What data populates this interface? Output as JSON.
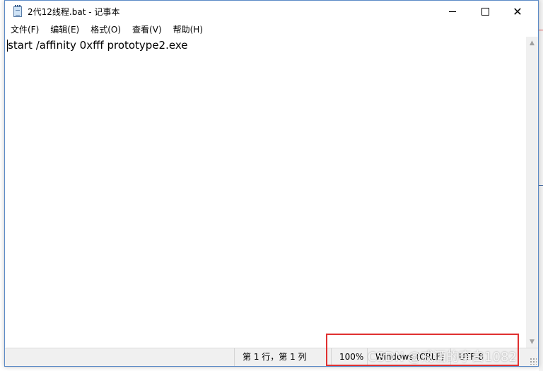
{
  "window": {
    "title": "2代12线程.bat - 记事本",
    "app_icon": "notepad-icon"
  },
  "menu": [
    {
      "label": "文件(F)"
    },
    {
      "label": "编辑(E)"
    },
    {
      "label": "格式(O)"
    },
    {
      "label": "查看(V)"
    },
    {
      "label": "帮助(H)"
    }
  ],
  "editor": {
    "content": "start /affinity 0xfff prototype2.exe"
  },
  "status": {
    "position": "第 1 行，第 1 列",
    "zoom": "100%",
    "line_ending": "Windows (CRLF)",
    "encoding": "UTF-8"
  },
  "watermark": {
    "text": "CSDN @戒酒的李白1082"
  },
  "colors": {
    "highlight_border": "#e03030",
    "window_border": "#5b8ac6"
  }
}
